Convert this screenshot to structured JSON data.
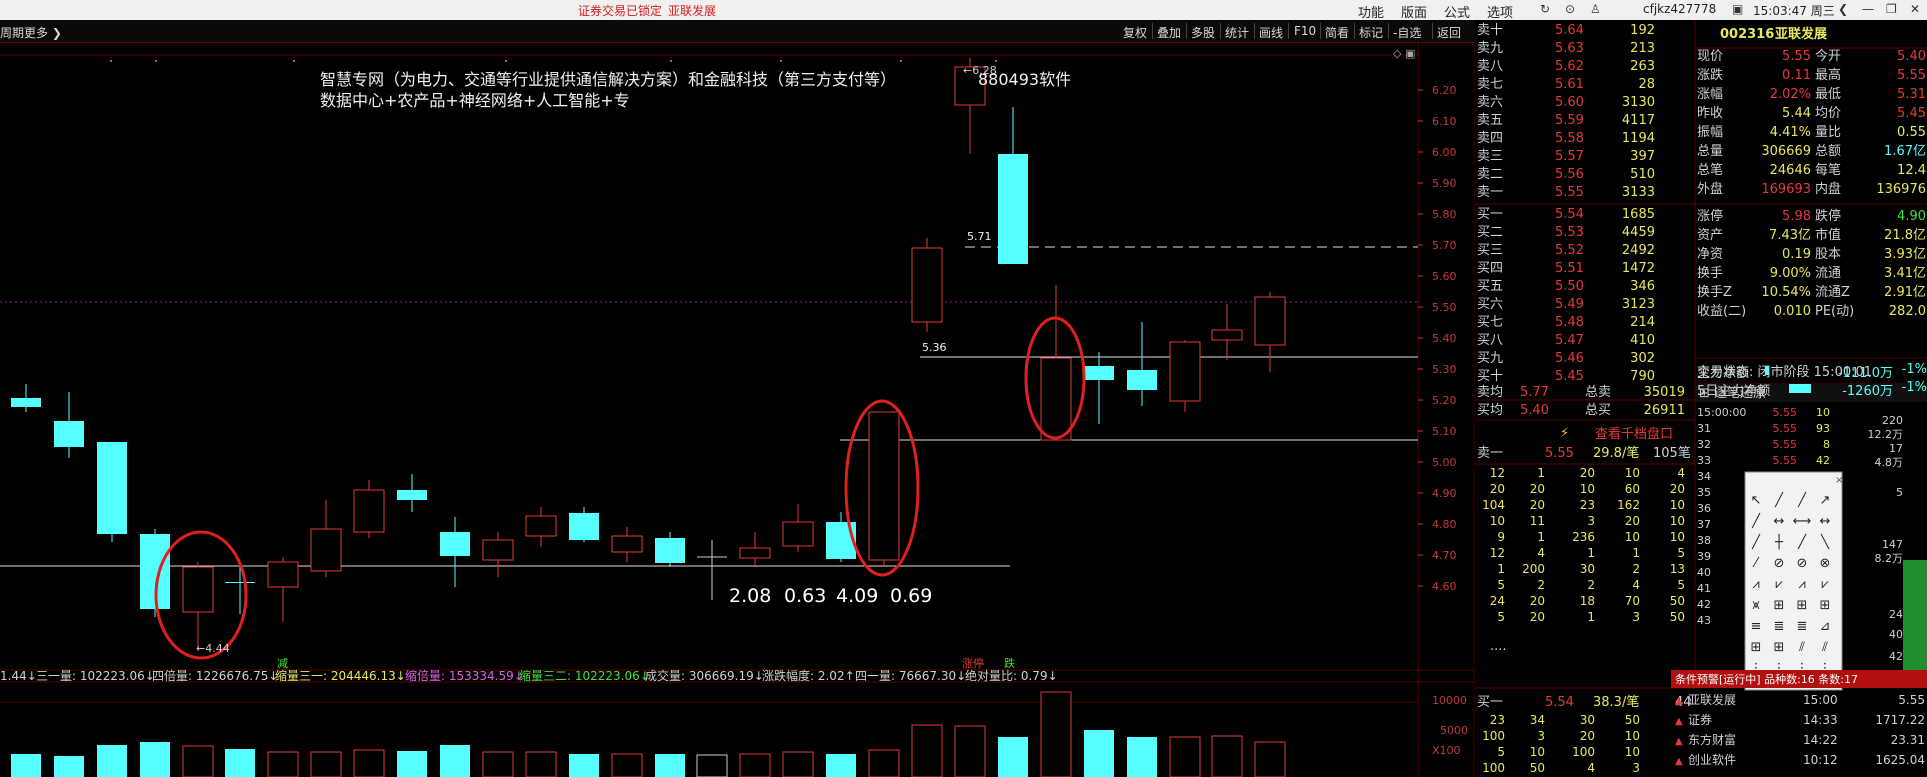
{
  "titlebar": {
    "alert1": "证券交易已锁定",
    "alert2": "亚联发展",
    "menus": [
      "功能",
      "版面",
      "公式",
      "选项"
    ],
    "user": "cfjkz427778",
    "time": "15:03:47 周三"
  },
  "toolbar": {
    "left_label": "周期",
    "more": "更多",
    "buttons": [
      "复权",
      "叠加",
      "多股",
      "统计",
      "画线",
      "F10",
      "简看",
      "标记",
      "-自选",
      "返回"
    ]
  },
  "chart": {
    "concept_line1": "智慧专网（为电力、交通等行业提供通信解决方案）和金融科技（第三方支付等）",
    "concept_code": "880493软件",
    "concept_line2": "数据中心+农产品+神经网络+人工智能+专",
    "price_ticks": [
      "6.20",
      "6.10",
      "6.00",
      "5.90",
      "5.80",
      "5.70",
      "5.60",
      "5.50",
      "5.40",
      "5.30",
      "5.20",
      "5.10",
      "5.00",
      "4.90",
      "4.80",
      "4.70",
      "4.60"
    ],
    "label_high": "6.28",
    "label_low": "4.44",
    "label_571": "5.71",
    "label_536": "5.36",
    "big_numbers": [
      "2.08",
      "0.63",
      "4.09",
      "0.69"
    ],
    "mark_jian": "减",
    "mark_zhangting": "涨停",
    "mark_die": "跌",
    "indicators": [
      {
        "text": "1.44↓",
        "color": "#d0d0d0"
      },
      {
        "text": "三一量: 102223.06↓",
        "color": "#d0d0d0"
      },
      {
        "text": "四倍量: 1226676.75↓",
        "color": "#d0d0d0"
      },
      {
        "text": "缩量三一: 204446.13↓",
        "color": "#e8e860"
      },
      {
        "text": "缩倍量: 153334.59↓",
        "color": "#e060e0"
      },
      {
        "text": "缩量三二: 102223.06↓",
        "color": "#40e040"
      },
      {
        "text": "成交量: 306669.19↓",
        "color": "#d0d0d0"
      },
      {
        "text": "涨跌幅度: 2.02↑",
        "color": "#d0d0d0"
      },
      {
        "text": "四一量: 76667.30↓",
        "color": "#d0d0d0"
      },
      {
        "text": "绝对量比: 0.79↓",
        "color": "#d0d0d0"
      }
    ],
    "vol_ticks": [
      "10000",
      "5000",
      "X100"
    ]
  },
  "orderbook": {
    "sell": [
      {
        "label": "卖十",
        "price": "5.64",
        "vol": "192"
      },
      {
        "label": "卖九",
        "price": "5.63",
        "vol": "213"
      },
      {
        "label": "卖八",
        "price": "5.62",
        "vol": "263"
      },
      {
        "label": "卖七",
        "price": "5.61",
        "vol": "28"
      },
      {
        "label": "卖六",
        "price": "5.60",
        "vol": "3130"
      },
      {
        "label": "卖五",
        "price": "5.59",
        "vol": "4117"
      },
      {
        "label": "卖四",
        "price": "5.58",
        "vol": "1194"
      },
      {
        "label": "卖三",
        "price": "5.57",
        "vol": "397"
      },
      {
        "label": "卖二",
        "price": "5.56",
        "vol": "510"
      },
      {
        "label": "卖一",
        "price": "5.55",
        "vol": "3133"
      }
    ],
    "buy": [
      {
        "label": "买一",
        "price": "5.54",
        "vol": "1685"
      },
      {
        "label": "买二",
        "price": "5.53",
        "vol": "4459"
      },
      {
        "label": "买三",
        "price": "5.52",
        "vol": "2492"
      },
      {
        "label": "买四",
        "price": "5.51",
        "vol": "1472"
      },
      {
        "label": "买五",
        "price": "5.50",
        "vol": "346"
      },
      {
        "label": "买六",
        "price": "5.49",
        "vol": "3123"
      },
      {
        "label": "买七",
        "price": "5.48",
        "vol": "214"
      },
      {
        "label": "买八",
        "price": "5.47",
        "vol": "410"
      },
      {
        "label": "买九",
        "price": "5.46",
        "vol": "302"
      },
      {
        "label": "买十",
        "price": "5.45",
        "vol": "790"
      }
    ],
    "avg_sell_label": "卖均",
    "avg_sell": "5.77",
    "total_sell_label": "总卖",
    "total_sell": "35019",
    "avg_buy_label": "买均",
    "avg_buy": "5.40",
    "total_buy_label": "总买",
    "total_buy": "26911",
    "view_thousand": "查看千档盘口",
    "queue_sell_label": "卖一",
    "queue_sell_price": "5.55",
    "queue_sell_per": "29.8/笔",
    "queue_sell_count": "105笔",
    "queue_sell_rows": [
      [
        "12",
        "1",
        "20",
        "10",
        "4"
      ],
      [
        "20",
        "20",
        "10",
        "60",
        "20"
      ],
      [
        "104",
        "20",
        "23",
        "162",
        "10"
      ],
      [
        "10",
        "11",
        "3",
        "20",
        "10"
      ],
      [
        "9",
        "1",
        "236",
        "10",
        "10"
      ],
      [
        "12",
        "4",
        "1",
        "1",
        "5"
      ],
      [
        "1",
        "200",
        "30",
        "2",
        "13"
      ],
      [
        "5",
        "2",
        "2",
        "4",
        "5"
      ],
      [
        "24",
        "20",
        "18",
        "70",
        "50"
      ],
      [
        "5",
        "20",
        "1",
        "3",
        "50"
      ]
    ],
    "ellipsis": "....",
    "queue_buy_label": "买一",
    "queue_buy_price": "5.54",
    "queue_buy_per": "38.3/笔",
    "queue_buy_count": "44",
    "queue_buy_rows": [
      [
        "23",
        "34",
        "30",
        "50"
      ],
      [
        "100",
        "3",
        "20",
        "10"
      ],
      [
        "5",
        "10",
        "100",
        "10"
      ],
      [
        "100",
        "50",
        "4",
        "3"
      ]
    ]
  },
  "quote": {
    "code": "002316",
    "name": "亚联发展",
    "rows": [
      [
        "现价",
        "5.55",
        "今开",
        "5.40"
      ],
      [
        "涨跌",
        "0.11",
        "最高",
        "5.55"
      ],
      [
        "涨幅",
        "2.02%",
        "最低",
        "5.31"
      ],
      [
        "昨收",
        "5.44",
        "均价",
        "5.45"
      ],
      [
        "振幅",
        "4.41%",
        "量比",
        "0.55"
      ],
      [
        "总量",
        "306669",
        "总额",
        "1.67亿"
      ],
      [
        "总笔",
        "24646",
        "每笔",
        "12.4"
      ],
      [
        "外盘",
        "169693",
        "内盘",
        "136976"
      ],
      [
        "涨停",
        "5.98",
        "跌停",
        "4.90"
      ],
      [
        "资产",
        "7.43亿",
        "市值",
        "21.8亿"
      ],
      [
        "净资",
        "0.19",
        "股本",
        "3.93亿"
      ],
      [
        "换手",
        "9.00%",
        "流通",
        "3.41亿"
      ],
      [
        "换手Z",
        "10.54%",
        "流通Z",
        "2.91亿"
      ],
      [
        "收益(二)",
        "0.010",
        "PE(动)",
        "282.0"
      ]
    ],
    "trade_status": "交易状态: 闭市阶段 15:00:01",
    "main_net_label": "主力净额",
    "main_net": "-111.0万",
    "main_net_pct": "-1%",
    "five_day_label": "5日主力净额",
    "five_day": "-1260万",
    "five_day_pct": "-1%"
  },
  "ticks": {
    "title": "逐笔还原",
    "rows": [
      [
        "15:00:00",
        "5.55",
        "10"
      ],
      [
        "31",
        "5.55",
        "93"
      ],
      [
        "32",
        "5.55",
        "8"
      ],
      [
        "33",
        "5.55",
        "42"
      ],
      [
        "34",
        "",
        ""
      ],
      [
        "35",
        "",
        ""
      ],
      [
        "36",
        "",
        ""
      ],
      [
        "37",
        "",
        ""
      ],
      [
        "38",
        "",
        ""
      ],
      [
        "39",
        "",
        ""
      ],
      [
        "40",
        "",
        ""
      ],
      [
        "41",
        "",
        ""
      ],
      [
        "42",
        "",
        ""
      ],
      [
        "43",
        "",
        ""
      ]
    ],
    "side_vals": [
      "220",
      "12.2万",
      "17",
      "4.8万",
      "5",
      "147",
      "8.2万",
      "24",
      "40",
      "42"
    ]
  },
  "alerts": {
    "header": "条件预警[运行中] 品种数:16 条数:17",
    "rows": [
      {
        "name": "亚联发展",
        "time": "15:00",
        "price": "5.55"
      },
      {
        "name": "证券",
        "time": "14:33",
        "price": "1717.22"
      },
      {
        "name": "东方财富",
        "time": "14:22",
        "price": "23.31"
      },
      {
        "name": "创业软件",
        "time": "10:12",
        "price": "1625.04"
      }
    ]
  },
  "colors": {
    "up": "#e53a3a",
    "down": "#55ffff",
    "bg": "#000000",
    "grid": "#5a0000"
  }
}
